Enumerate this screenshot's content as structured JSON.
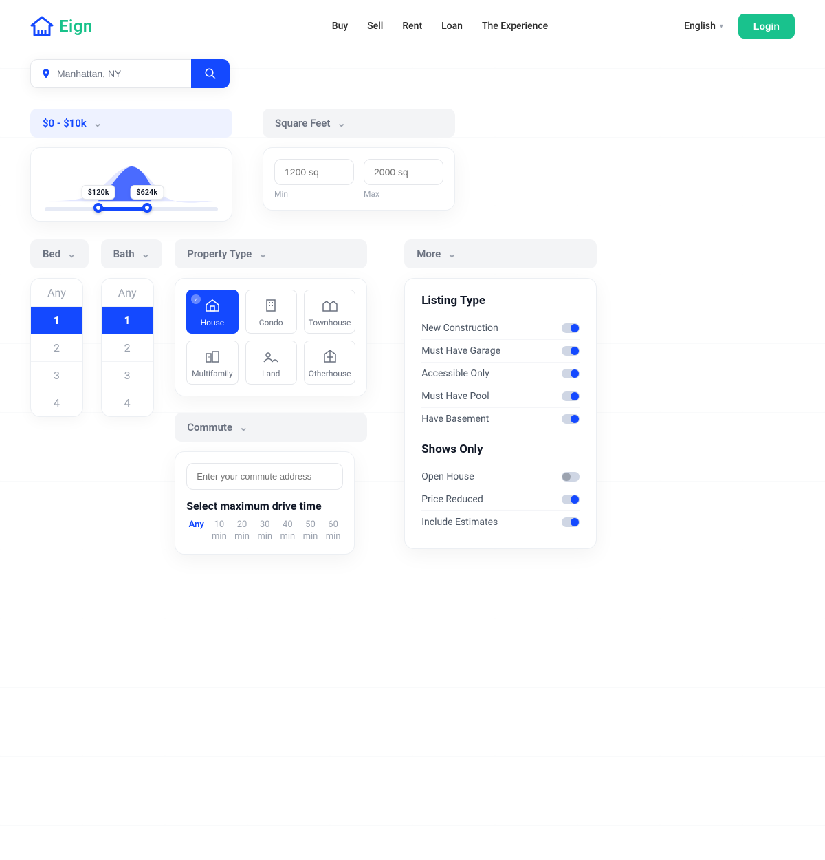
{
  "brand": {
    "name": "Eign"
  },
  "nav": {
    "buy": "Buy",
    "sell": "Sell",
    "rent": "Rent",
    "loan": "Loan",
    "experience": "The Experience"
  },
  "header": {
    "language": "English",
    "login": "Login"
  },
  "search": {
    "value": "Manhattan, NY"
  },
  "price": {
    "label": "$0 - $10k",
    "minTag": "$120k",
    "maxTag": "$624k"
  },
  "sqft": {
    "label": "Square Feet",
    "minPlaceholder": "1200 sq",
    "maxPlaceholder": "2000 sq",
    "minLabel": "Min",
    "maxLabel": "Max"
  },
  "bed": {
    "label": "Bed",
    "options": [
      "Any",
      "1",
      "2",
      "3",
      "4"
    ],
    "selected": "1"
  },
  "bath": {
    "label": "Bath",
    "options": [
      "Any",
      "1",
      "2",
      "3",
      "4"
    ],
    "selected": "1"
  },
  "ptype": {
    "label": "Property Type",
    "items": [
      {
        "key": "house",
        "label": "House",
        "active": true
      },
      {
        "key": "condo",
        "label": "Condo",
        "active": false
      },
      {
        "key": "townhouse",
        "label": "Townhouse",
        "active": false
      },
      {
        "key": "multifamily",
        "label": "Multifamily",
        "active": false
      },
      {
        "key": "land",
        "label": "Land",
        "active": false
      },
      {
        "key": "otherhouse",
        "label": "Otherhouse",
        "active": false
      }
    ]
  },
  "commute": {
    "label": "Commute",
    "placeholder": "Enter your commute address",
    "driveTitle": "Select maximum drive time",
    "options": [
      "Any",
      "10 min",
      "20 min",
      "30 min",
      "40 min",
      "50 min",
      "60 min"
    ],
    "selected": "Any"
  },
  "more": {
    "label": "More",
    "listingTitle": "Listing Type",
    "listing": [
      {
        "label": "New Construction",
        "on": true
      },
      {
        "label": "Must Have Garage",
        "on": true
      },
      {
        "label": "Accessible Only",
        "on": true
      },
      {
        "label": "Must Have Pool",
        "on": true
      },
      {
        "label": "Have Basement",
        "on": true
      }
    ],
    "showsTitle": "Shows Only",
    "shows": [
      {
        "label": "Open House",
        "on": false
      },
      {
        "label": "Price Reduced",
        "on": true
      },
      {
        "label": "Include Estimates",
        "on": true
      }
    ]
  },
  "colors": {
    "accent": "#1449ff",
    "green": "#19c28d"
  }
}
